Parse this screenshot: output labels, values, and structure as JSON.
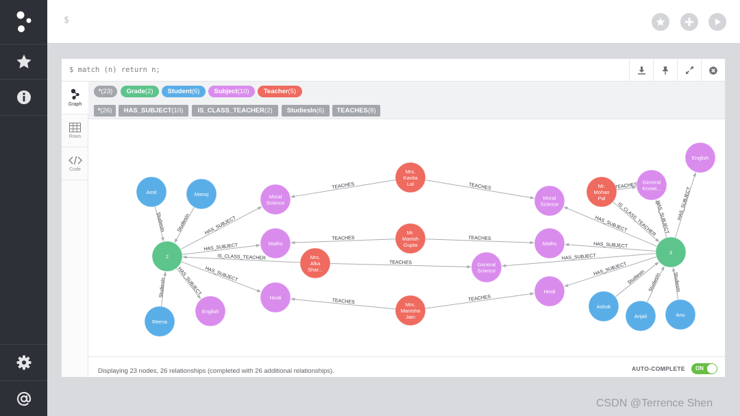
{
  "editor": {
    "prompt": "$"
  },
  "query": "$ match (n) return n;",
  "tabs": [
    {
      "label": "Graph",
      "icon": "graph-icon"
    },
    {
      "label": "Rows",
      "icon": "table-icon"
    },
    {
      "label": "Code",
      "icon": "code-icon"
    }
  ],
  "labels": [
    {
      "name": "*",
      "count": "(23)",
      "color": "#a3a6ab"
    },
    {
      "name": "Grade",
      "count": "(2)",
      "color": "#5dc48b"
    },
    {
      "name": "Student",
      "count": "(6)",
      "color": "#5aaee8"
    },
    {
      "name": "Subject",
      "count": "(10)",
      "color": "#da8ced"
    },
    {
      "name": "Teacher",
      "count": "(5)",
      "color": "#ef6a5f"
    }
  ],
  "relationships": [
    {
      "name": "*",
      "count": "(26)"
    },
    {
      "name": "HAS_SUBJECT",
      "count": "(10)"
    },
    {
      "name": "IS_CLASS_TEACHER",
      "count": "(2)"
    },
    {
      "name": "StudiesIn",
      "count": "(6)"
    },
    {
      "name": "TEACHES",
      "count": "(8)"
    }
  ],
  "graph": {
    "colors": {
      "Grade": "#5dc48b",
      "Student": "#5aaee8",
      "Subject": "#da8ced",
      "Teacher": "#ef6a5f"
    },
    "nodes": [
      {
        "id": "g2",
        "label": "Grade",
        "text": [
          "2"
        ]
      },
      {
        "id": "g3",
        "label": "Grade",
        "text": [
          "3"
        ]
      },
      {
        "id": "amit",
        "label": "Student",
        "text": [
          "Amit"
        ]
      },
      {
        "id": "manoj",
        "label": "Student",
        "text": [
          "Manoj"
        ]
      },
      {
        "id": "reena",
        "label": "Student",
        "text": [
          "Reena"
        ]
      },
      {
        "id": "ashok",
        "label": "Student",
        "text": [
          "Ashok"
        ]
      },
      {
        "id": "anjali",
        "label": "Student",
        "text": [
          "Anjali"
        ]
      },
      {
        "id": "anu",
        "label": "Student",
        "text": [
          "Anu"
        ]
      },
      {
        "id": "ms2",
        "label": "Subject",
        "text": [
          "Moral",
          "Science"
        ]
      },
      {
        "id": "ma2",
        "label": "Subject",
        "text": [
          "Maths"
        ]
      },
      {
        "id": "hi2",
        "label": "Subject",
        "text": [
          "Hindi"
        ]
      },
      {
        "id": "en2",
        "label": "Subject",
        "text": [
          "English"
        ]
      },
      {
        "id": "gs",
        "label": "Subject",
        "text": [
          "General",
          "Science"
        ]
      },
      {
        "id": "ms3",
        "label": "Subject",
        "text": [
          "Moral",
          "Science"
        ]
      },
      {
        "id": "ma3",
        "label": "Subject",
        "text": [
          "Maths"
        ]
      },
      {
        "id": "hi3",
        "label": "Subject",
        "text": [
          "Hindi"
        ]
      },
      {
        "id": "gk",
        "label": "Subject",
        "text": [
          "General",
          "Knowl..."
        ]
      },
      {
        "id": "en3",
        "label": "Subject",
        "text": [
          "English"
        ]
      },
      {
        "id": "kavita",
        "label": "Teacher",
        "text": [
          "Mrs.",
          "Kavita",
          "Lal"
        ]
      },
      {
        "id": "manish",
        "label": "Teacher",
        "text": [
          "Mr.",
          "Manish",
          "Gupta"
        ]
      },
      {
        "id": "alka",
        "label": "Teacher",
        "text": [
          "Mrs.",
          "Alka",
          "Shar..."
        ]
      },
      {
        "id": "manisha",
        "label": "Teacher",
        "text": [
          "Mrs.",
          "Manisha",
          "Jain"
        ]
      },
      {
        "id": "mohan",
        "label": "Teacher",
        "text": [
          "Mr.",
          "Mohan",
          "Pal"
        ]
      }
    ],
    "edges": [
      {
        "from": "amit",
        "to": "g2",
        "type": "StudiesIn"
      },
      {
        "from": "manoj",
        "to": "g2",
        "type": "StudiesIn"
      },
      {
        "from": "reena",
        "to": "g2",
        "type": "StudiesIn"
      },
      {
        "from": "g2",
        "to": "ms2",
        "type": "HAS_SUBJECT"
      },
      {
        "from": "g2",
        "to": "ma2",
        "type": "HAS_SUBJECT"
      },
      {
        "from": "g2",
        "to": "hi2",
        "type": "HAS_SUBJECT"
      },
      {
        "from": "g2",
        "to": "en2",
        "type": "HAS_SUBJECT"
      },
      {
        "from": "alka",
        "to": "g2",
        "type": "IS_CLASS_TEACHER"
      },
      {
        "from": "kavita",
        "to": "ms2",
        "type": "TEACHES"
      },
      {
        "from": "kavita",
        "to": "ms3",
        "type": "TEACHES"
      },
      {
        "from": "manish",
        "to": "ma2",
        "type": "TEACHES"
      },
      {
        "from": "manish",
        "to": "ma3",
        "type": "TEACHES"
      },
      {
        "from": "alka",
        "to": "gs",
        "type": "TEACHES"
      },
      {
        "from": "manisha",
        "to": "hi2",
        "type": "TEACHES"
      },
      {
        "from": "manisha",
        "to": "hi3",
        "type": "TEACHES"
      },
      {
        "from": "mohan",
        "to": "gk",
        "type": "TEACHES"
      },
      {
        "from": "mohan",
        "to": "g3",
        "type": "IS_CLASS_TEACHER"
      },
      {
        "from": "g3",
        "to": "ms3",
        "type": "HAS_SUBJECT"
      },
      {
        "from": "g3",
        "to": "ma3",
        "type": "HAS_SUBJECT"
      },
      {
        "from": "g3",
        "to": "gs",
        "type": "HAS_SUBJECT"
      },
      {
        "from": "g3",
        "to": "hi3",
        "type": "HAS_SUBJECT"
      },
      {
        "from": "g3",
        "to": "gk",
        "type": "HAS_SUBJECT"
      },
      {
        "from": "g3",
        "to": "en3",
        "type": "HAS_SUBJECT"
      },
      {
        "from": "ashok",
        "to": "g3",
        "type": "StudiesIn"
      },
      {
        "from": "anjali",
        "to": "g3",
        "type": "StudiesIn"
      },
      {
        "from": "anu",
        "to": "g3",
        "type": "StudiesIn"
      }
    ]
  },
  "footer": {
    "status": "Displaying 23 nodes, 26 relationships (completed with 26 additional relationships).",
    "autocomplete_label": "AUTO-COMPLETE",
    "toggle_label": "ON"
  },
  "watermark": "CSDN @Terrence Shen"
}
